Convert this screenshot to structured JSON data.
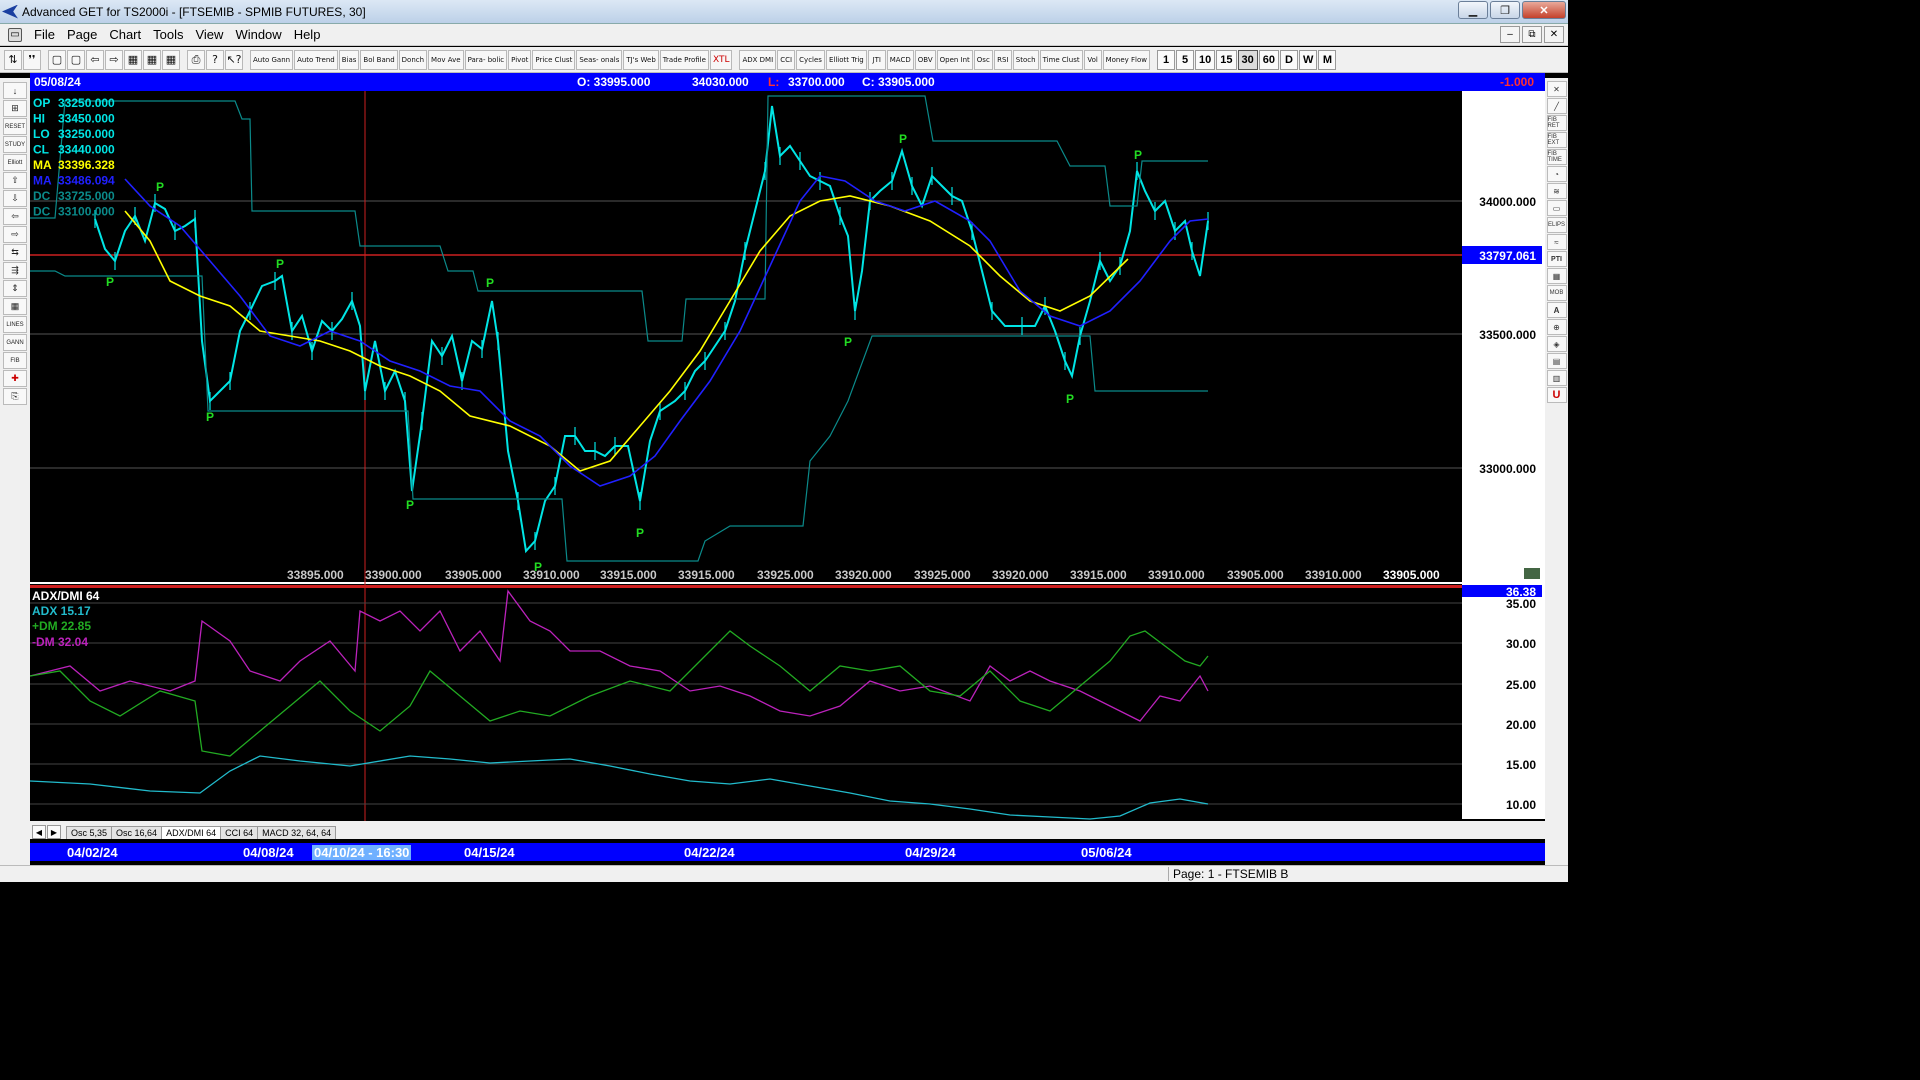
{
  "window": {
    "title": "Advanced GET for TS2000i - [FTSEMIB - SPMIB FUTURES, 30]",
    "min": "▁",
    "max": "❐",
    "close": "✕"
  },
  "menu": {
    "items": [
      "File",
      "Page",
      "Chart",
      "Tools",
      "View",
      "Window",
      "Help"
    ],
    "mdi_min": "–",
    "mdi_restore": "⧉",
    "mdi_close": "✕"
  },
  "toolbar": {
    "icons_a": [
      "⇅",
      "❜❜"
    ],
    "icons_b": [
      "▢",
      "▢",
      "⇦",
      "⇨",
      "▦",
      "▦",
      "▦"
    ],
    "icons_c": [
      "⎙",
      "?",
      "↖?"
    ],
    "studies": [
      "Auto Gann",
      "Auto Trend",
      "Bias",
      "Bol Band",
      "Donch",
      "Mov Ave",
      "Para- bolic",
      "Pivot",
      "Price Clust",
      "Seas- onals",
      "TJ's Web",
      "Trade Profile",
      "XTL"
    ],
    "oscs": [
      "ADX DMI",
      "CCI",
      "Cycles",
      "Elliott Trig",
      "JTI",
      "MACD",
      "OBV",
      "Open Int",
      "Osc",
      "RSI",
      "Stoch",
      "Time Clust",
      "Vol",
      "Money Flow"
    ],
    "intervals": [
      "1",
      "5",
      "10",
      "15",
      "30",
      "60",
      "D",
      "W",
      "M"
    ],
    "active_interval": "30"
  },
  "left_tools": [
    "↓",
    "⊞",
    "RESET",
    "STUDY",
    "Elliott",
    "⇧",
    "⇩",
    "⇦",
    "⇨",
    "⇆",
    "⇶",
    "⇕",
    "▦",
    "LINES",
    "GANN",
    "FIB",
    "✚",
    "⎘"
  ],
  "right_tools": [
    "✕",
    "╱",
    "FIB RET",
    "FIB EXT",
    "FIB TIME",
    "◔",
    "≋",
    "▭",
    "ELIPS",
    "≈",
    "PTI",
    "▦",
    "MOB",
    "A",
    "⊕",
    "◈",
    "▤",
    "▥",
    "U"
  ],
  "info_bar": {
    "date": "05/08/24",
    "open": "O: 33995.000",
    "high": "34030.000",
    "low_label": "L:",
    "low": "33700.000",
    "close": "C: 33905.000",
    "change": "-1.000"
  },
  "price_legend": [
    {
      "label": "OP",
      "value": "33250.000",
      "color": "#00e5e5"
    },
    {
      "label": "HI",
      "value": "33450.000",
      "color": "#00e5e5"
    },
    {
      "label": "LO",
      "value": "33250.000",
      "color": "#00e5e5"
    },
    {
      "label": "CL",
      "value": "33440.000",
      "color": "#00e5e5"
    },
    {
      "label": "MA",
      "value": "33396.328",
      "color": "#ffff00"
    },
    {
      "label": "MA",
      "value": "33486.094",
      "color": "#2020ff"
    },
    {
      "label": "DC",
      "value": "33725.000",
      "color": "#0b8a8a"
    },
    {
      "label": "DC",
      "value": "33100.000",
      "color": "#0b8a8a"
    }
  ],
  "price_axis": {
    "labels": [
      "34000.000",
      "33500.000",
      "33000.000"
    ],
    "current": "33797.061"
  },
  "bottom_values": [
    "33895.000",
    "33900.000",
    "33905.000",
    "33910.000",
    "33915.000",
    "33915.000",
    "33925.000",
    "33920.000",
    "33925.000",
    "33920.000",
    "33915.000",
    "33910.000",
    "33905.000",
    "33910.000",
    "33905.000"
  ],
  "pivot_label": "P",
  "indicator": {
    "title": "ADX/DMI 64",
    "adx": "ADX 15.17",
    "pdm": "+DM 22.85",
    "mdm": "-DM 32.04",
    "axis": [
      "35.00",
      "30.00",
      "25.00",
      "20.00",
      "15.00",
      "10.00"
    ],
    "current": "36.38"
  },
  "tabs": [
    "Osc 5,35",
    "Osc 16,64",
    "ADX/DMI 64",
    "CCI 64",
    "MACD 32, 64, 64"
  ],
  "active_tab": "ADX/DMI 64",
  "tab_nav": {
    "left": "◀",
    "right": "▶"
  },
  "dates": {
    "d1": "04/02/24",
    "d2": "04/08/24",
    "cursor": "04/10/24 - 16:30",
    "d4": "04/15/24",
    "d5": "04/22/24",
    "d6": "04/29/24",
    "d7": "05/06/24"
  },
  "status": "Page: 1 - FTSEMIB B",
  "colors": {
    "bars": "#00e5e5",
    "ma_fast": "#ffff00",
    "ma_slow": "#2020ff",
    "donchian": "#0b8a8a",
    "pivot": "#22dd22",
    "adx": "#22bbcc",
    "pdm": "#22aa22",
    "mdm": "#bb22bb",
    "cursor": "#cc2020",
    "info_bg": "#0000ff"
  }
}
